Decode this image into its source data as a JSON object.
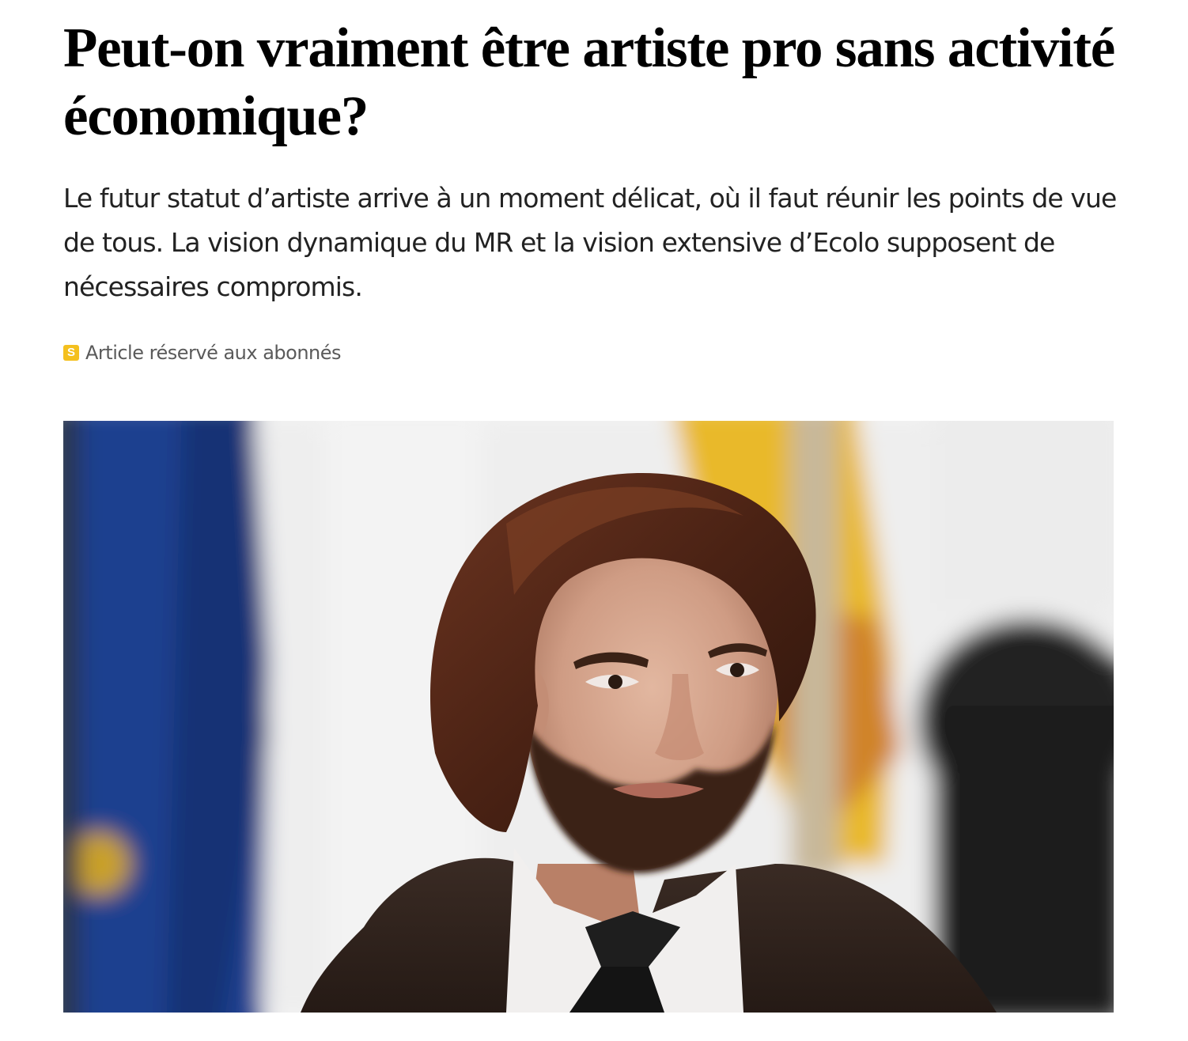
{
  "article": {
    "headline": "Peut-on vraiment être artiste pro sans activité économique?",
    "chapo": "Le futur statut d’artiste arrive à un moment délicat, où il faut réunir les points de vue de tous. La vision dynamique du MR et la vision extensive d’Ecolo supposent de nécessaires compromis.",
    "paywall": {
      "icon_letter": "S",
      "label": "Article réservé aux abonnés",
      "icon_color": "#f4c01e"
    },
    "image": {
      "kind": "photo"
    }
  }
}
